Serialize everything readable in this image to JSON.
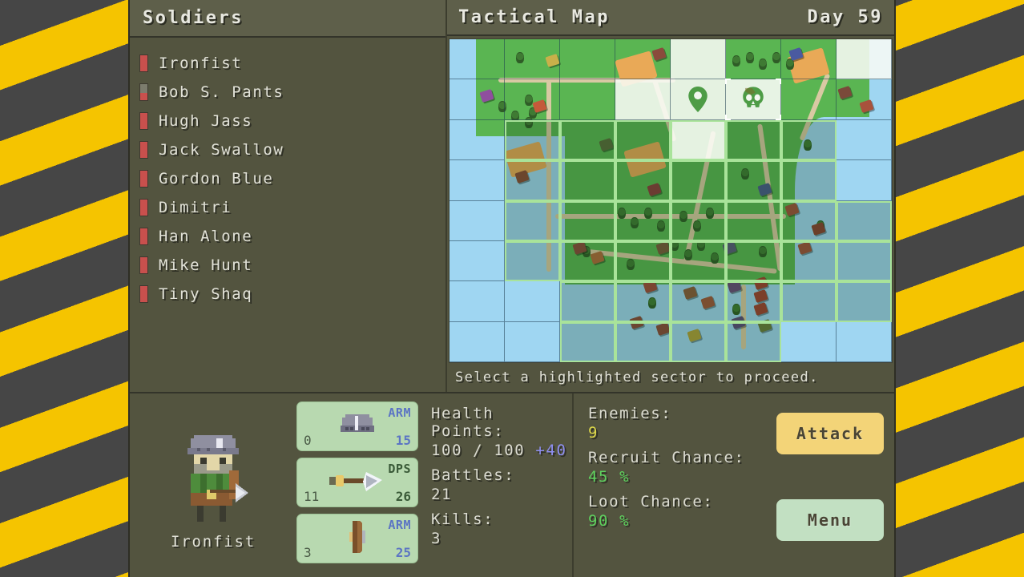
{
  "sidebar": {
    "title": "Soldiers",
    "soldiers": [
      {
        "name": "Ironfist",
        "hp_pct": 100
      },
      {
        "name": "Bob S. Pants",
        "hp_pct": 45
      },
      {
        "name": "Hugh Jass",
        "hp_pct": 100
      },
      {
        "name": "Jack Swallow",
        "hp_pct": 100
      },
      {
        "name": "Gordon Blue",
        "hp_pct": 100
      },
      {
        "name": "Dimitri",
        "hp_pct": 100
      },
      {
        "name": "Han Alone",
        "hp_pct": 100
      },
      {
        "name": "Mike Hunt",
        "hp_pct": 100
      },
      {
        "name": "Tiny Shaq",
        "hp_pct": 100
      }
    ]
  },
  "map": {
    "title": "Tactical Map",
    "day_label": "Day 59",
    "hint": "Select a highlighted sector to proceed.",
    "grid": {
      "cols": 8,
      "rows": 8
    },
    "marker_icon": "location-pin-icon",
    "objective_icon": "skull-icon"
  },
  "character": {
    "name": "Ironfist",
    "portrait_icon": "soldier-portrait-icon",
    "items": [
      {
        "icon": "helmet-icon",
        "tag": "ARM",
        "tag_kind": "arm",
        "left_value": "0",
        "right_value": "15"
      },
      {
        "icon": "axe-icon",
        "tag": "DPS",
        "tag_kind": "dps",
        "left_value": "11",
        "right_value": "26"
      },
      {
        "icon": "shield-icon",
        "tag": "ARM",
        "tag_kind": "arm",
        "left_value": "3",
        "right_value": "25"
      }
    ]
  },
  "stats": {
    "health_label": "Health Points:",
    "health_value": "100 / 100 ",
    "health_bonus": "+40",
    "battles_label": "Battles:",
    "battles_value": "21",
    "kills_label": "Kills:",
    "kills_value": "3"
  },
  "encounter": {
    "enemies_label": "Enemies:",
    "enemies_value": "9",
    "recruit_label": "Recruit Chance:",
    "recruit_value": "45 %",
    "loot_label": "Loot Chance:",
    "loot_value": "90 %"
  },
  "actions": {
    "attack_label": "Attack",
    "menu_label": "Menu"
  },
  "colors": {
    "panel": "#53543f",
    "header": "#5e5f4a",
    "hazard_yellow": "#f5c400",
    "hazard_dark": "#464646",
    "card": "#b8d9b0",
    "attack": "#f3d478",
    "menu": "#c2e0c2",
    "hp_red": "#c8504d",
    "value_green": "#5ed15e",
    "value_yellow": "#ddd84a",
    "bonus_purple": "#8e8ef0"
  }
}
